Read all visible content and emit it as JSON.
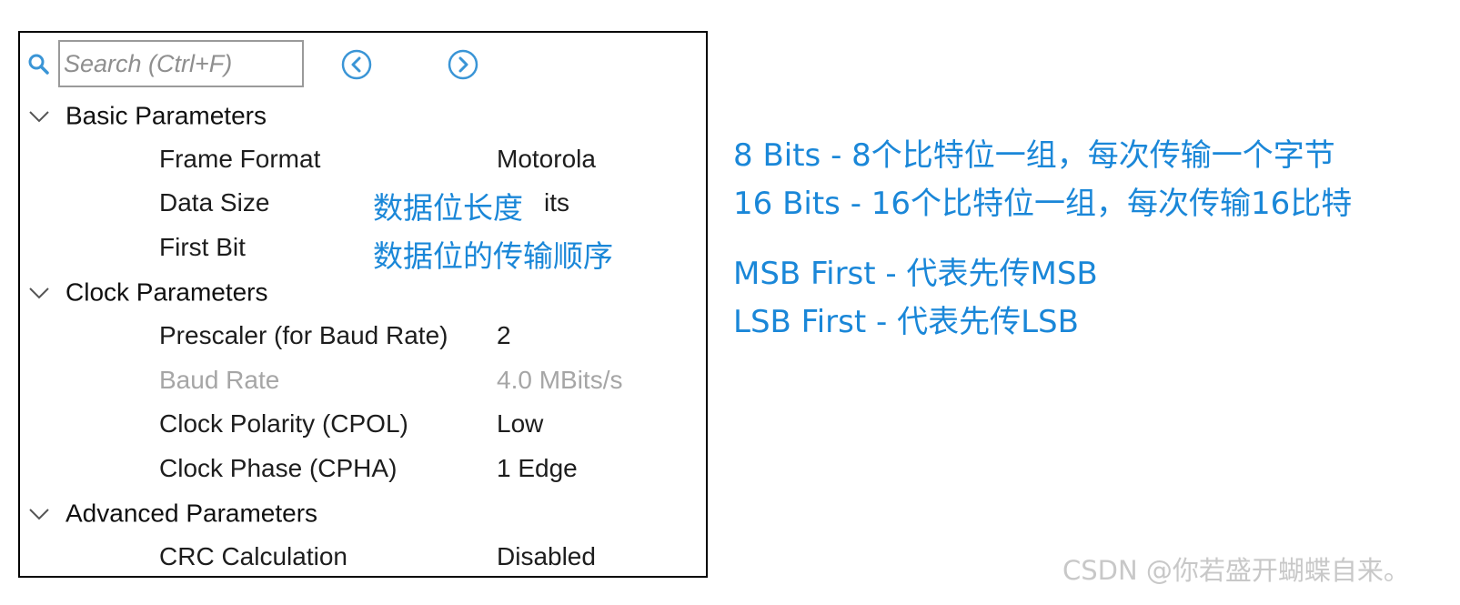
{
  "search": {
    "placeholder": "Search (Ctrl+F)"
  },
  "sections": {
    "basic": {
      "label": "Basic Parameters",
      "frame_format": {
        "name": "Frame Format",
        "value": "Motorola"
      },
      "data_size": {
        "name": "Data Size",
        "value_fragment": "its"
      },
      "first_bit": {
        "name": "First Bit"
      }
    },
    "clock": {
      "label": "Clock Parameters",
      "prescaler": {
        "name": "Prescaler (for Baud Rate)",
        "value": "2"
      },
      "baud_rate": {
        "name": "Baud Rate",
        "value": "4.0 MBits/s"
      },
      "cpol": {
        "name": "Clock Polarity (CPOL)",
        "value": "Low"
      },
      "cpha": {
        "name": "Clock Phase (CPHA)",
        "value": "1 Edge"
      }
    },
    "advanced": {
      "label": "Advanced Parameters",
      "crc": {
        "name": "CRC Calculation",
        "value": "Disabled"
      }
    }
  },
  "annotations": {
    "data_size": "数据位长度",
    "first_bit": "数据位的传输顺序"
  },
  "notes": [
    "8 Bits -   8个比特位一组，每次传输一个字节",
    "16 Bits - 16个比特位一组，每次传输16比特",
    "MSB First - 代表先传MSB",
    "LSB First   - 代表先传LSB"
  ],
  "watermark": "CSDN @你若盛开蝴蝶自来。",
  "colors": {
    "annotation": "#1a87d8",
    "icon": "#3a95d6",
    "disabled": "#a6a6a6"
  },
  "icons": {
    "search": "search-icon",
    "prev": "circle-chevron-left-icon",
    "next": "circle-chevron-right-icon",
    "collapse": "chevron-down-icon"
  }
}
